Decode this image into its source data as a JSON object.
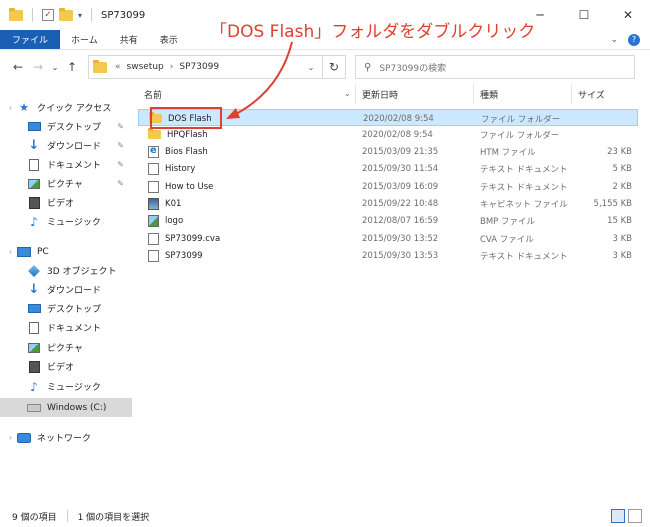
{
  "window": {
    "title": "SP73099"
  },
  "annotation": {
    "text": "「DOS Flash」フォルダをダブルクリック",
    "color": "#e04030"
  },
  "ribbon": {
    "tabs": [
      {
        "label": "ファイル"
      },
      {
        "label": "ホーム"
      },
      {
        "label": "共有"
      },
      {
        "label": "表示"
      }
    ]
  },
  "address": {
    "prefix": "«",
    "segments": [
      "swsetup",
      "SP73099"
    ]
  },
  "search": {
    "placeholder": "SP73099の検索"
  },
  "nav": {
    "quick_access": "クイック アクセス",
    "quick_items": [
      "デスクトップ",
      "ダウンロード",
      "ドキュメント",
      "ピクチャ",
      "ビデオ",
      "ミュージック"
    ],
    "pc": "PC",
    "pc_items": [
      "3D オブジェクト",
      "ダウンロード",
      "デスクトップ",
      "ドキュメント",
      "ピクチャ",
      "ビデオ",
      "ミュージック",
      "Windows (C:)"
    ],
    "network": "ネットワーク"
  },
  "columns": {
    "name": "名前",
    "date": "更新日時",
    "type": "種類",
    "size": "サイズ"
  },
  "files": [
    {
      "name": "DOS Flash",
      "date": "2020/02/08 9:54",
      "type": "ファイル フォルダー",
      "size": "",
      "icon": "folder-icon"
    },
    {
      "name": "HPQFlash",
      "date": "2020/02/08 9:54",
      "type": "ファイル フォルダー",
      "size": "",
      "icon": "folder-icon"
    },
    {
      "name": "Bios Flash",
      "date": "2015/03/09 21:35",
      "type": "HTM ファイル",
      "size": "23 KB",
      "icon": "htm-file-icon"
    },
    {
      "name": "History",
      "date": "2015/09/30 11:54",
      "type": "テキスト ドキュメント",
      "size": "5 KB",
      "icon": "text-file-icon"
    },
    {
      "name": "How to Use",
      "date": "2015/03/09 16:09",
      "type": "テキスト ドキュメント",
      "size": "2 KB",
      "icon": "text-file-icon"
    },
    {
      "name": "K01",
      "date": "2015/09/22 10:48",
      "type": "キャビネット ファイル",
      "size": "5,155 KB",
      "icon": "cab-file-icon"
    },
    {
      "name": "logo",
      "date": "2012/08/07 16:59",
      "type": "BMP ファイル",
      "size": "15 KB",
      "icon": "bmp-file-icon"
    },
    {
      "name": "SP73099.cva",
      "date": "2015/09/30 13:52",
      "type": "CVA ファイル",
      "size": "3 KB",
      "icon": "text-file-icon"
    },
    {
      "name": "SP73099",
      "date": "2015/09/30 13:53",
      "type": "テキスト ドキュメント",
      "size": "3 KB",
      "icon": "text-file-icon"
    }
  ],
  "status": {
    "count": "9 個の項目",
    "selected": "1 個の項目を選択"
  },
  "colors": {
    "accent": "#1a5fb4",
    "selection": "#cce8ff"
  }
}
